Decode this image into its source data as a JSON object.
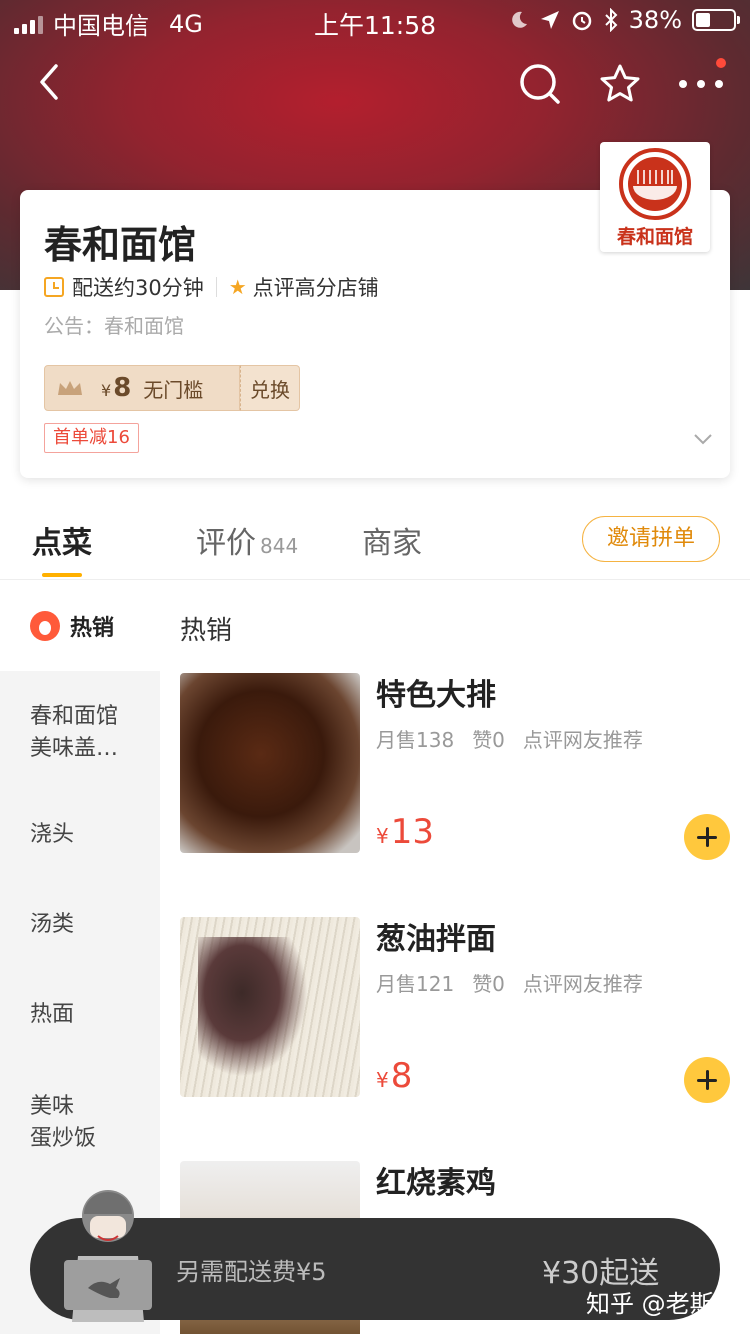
{
  "status_bar": {
    "carrier": "中国电信",
    "network": "4G",
    "time": "上午11:58",
    "battery": "38%",
    "battery_level": 0.38
  },
  "shop": {
    "name": "春和面馆",
    "delivery_time": "配送约30分钟",
    "badge": "点评高分店铺",
    "notice": "公告：春和面馆",
    "logo_text": "春和面馆",
    "coupon": {
      "currency": "¥",
      "amount": "8",
      "condition": "无门槛",
      "action": "兑换"
    },
    "first_order_tag": "首单减16"
  },
  "tabs": [
    {
      "label": "点菜",
      "count": ""
    },
    {
      "label": "评价",
      "count": "844"
    },
    {
      "label": "商家",
      "count": ""
    }
  ],
  "invite_button": "邀请拼单",
  "sidebar": {
    "active": "热销",
    "items": [
      "春和面馆\n美味盖…",
      "浇头",
      "汤类",
      "热面",
      "美味\n蛋炒饭"
    ]
  },
  "section_title": "热销",
  "dishes": [
    {
      "name": "特色大排",
      "monthly_sales": "月售138",
      "likes": "赞0",
      "tag": "点评网友推荐",
      "currency": "¥",
      "price": "13"
    },
    {
      "name": "葱油拌面",
      "monthly_sales": "月售121",
      "likes": "赞0",
      "tag": "点评网友推荐",
      "currency": "¥",
      "price": "8"
    },
    {
      "name": "红烧素鸡",
      "monthly_sales": "",
      "likes": "",
      "tag": "",
      "currency": "",
      "price": ""
    }
  ],
  "cart": {
    "extra_fee": "另需配送费¥5",
    "min_order": "¥30起送"
  },
  "watermark": "知乎 @老斯基",
  "colors": {
    "accent": "#ffc83d",
    "price_red": "#ec4a3a",
    "hero_red": "#a8202e",
    "cart_bg": "#333333"
  }
}
